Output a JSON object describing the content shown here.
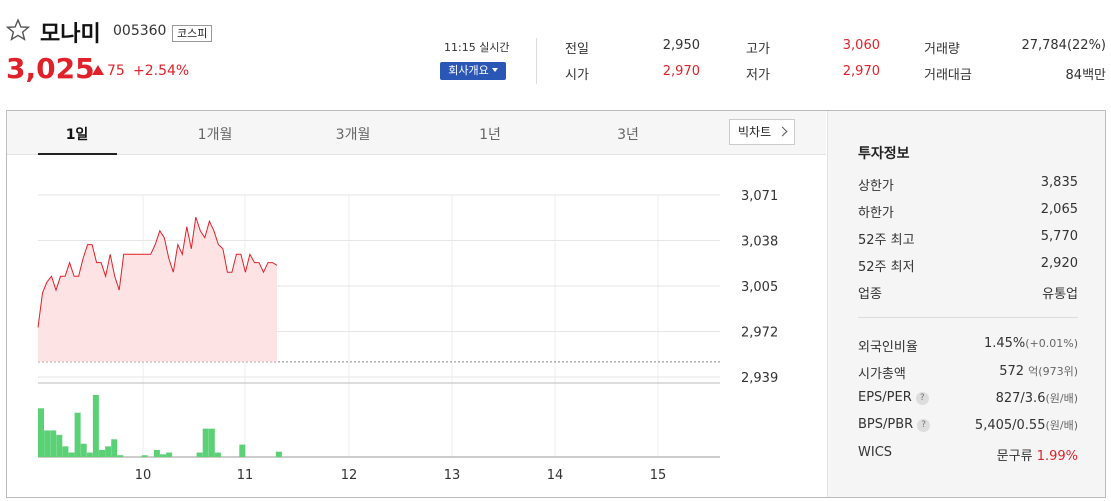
{
  "stock": {
    "name": "모나미",
    "code": "005360",
    "market": "코스피",
    "price": "3,025",
    "change": "75",
    "rate": "+2.54%"
  },
  "header": {
    "realtime": "11:15 실시간",
    "company_btn": "회사개요",
    "stats": [
      {
        "label": "전일",
        "value": "2,950",
        "color": "#333333"
      },
      {
        "label": "시가",
        "value": "2,970",
        "color": "#e0212a"
      },
      {
        "label": "고가",
        "value": "3,060",
        "color": "#e0212a"
      },
      {
        "label": "저가",
        "value": "2,970",
        "color": "#e0212a"
      },
      {
        "label": "거래량",
        "value": "27,784(22%)",
        "color": "#333333"
      },
      {
        "label": "거래대금",
        "value": "84백만",
        "color": "#333333"
      }
    ]
  },
  "tabs": [
    "1일",
    "1개월",
    "3개월",
    "1년",
    "3년"
  ],
  "bigchart": "빅차트",
  "info": {
    "title": "투자정보",
    "rows1": [
      {
        "label": "상한가",
        "value": "3,835",
        "color": "#e0212a"
      },
      {
        "label": "하한가",
        "value": "2,065",
        "color": "#2a57b6"
      },
      {
        "label": "52주 최고",
        "value": "5,770",
        "color": "#333333"
      },
      {
        "label": "52주 최저",
        "value": "2,920",
        "color": "#333333"
      },
      {
        "label": "업종",
        "value": "유통업",
        "color": "#333333"
      }
    ],
    "foreign": {
      "label": "외국인비율",
      "value": "1.45%",
      "sub": "(+0.01%)"
    },
    "mktcap": {
      "label": "시가총액",
      "value": "572",
      "sub": "억(973위)"
    },
    "eps": {
      "label": "EPS/PER",
      "value": "827/3.6",
      "sub": "(원/배)"
    },
    "bps": {
      "label": "BPS/PBR",
      "value": "5,405/0.55",
      "sub": "(원/배)"
    },
    "wics": {
      "label": "WICS",
      "value": "문구류",
      "rate": "1.99%"
    }
  },
  "chart_data": {
    "type": "line",
    "x_ticks": [
      "10",
      "11",
      "12",
      "13",
      "14",
      "15"
    ],
    "y_ticks": [
      "3,071",
      "3,038",
      "3,005",
      "2,972",
      "2,939"
    ],
    "ylim": [
      2939,
      3071
    ],
    "prev_close": 2950,
    "price": [
      2975,
      3000,
      3008,
      3012,
      3002,
      3012,
      3012,
      3022,
      3012,
      3012,
      3025,
      3035,
      3035,
      3022,
      3022,
      3012,
      3028,
      3012,
      3002,
      3028,
      3028,
      3028,
      3028,
      3028,
      3028,
      3028,
      3035,
      3045,
      3040,
      3025,
      3015,
      3035,
      3028,
      3048,
      3032,
      3055,
      3045,
      3040,
      3052,
      3045,
      3035,
      3032,
      3015,
      3015,
      3028,
      3028,
      3015,
      3028,
      3022,
      3022,
      3015,
      3022,
      3022,
      3020
    ],
    "volume": [
      55,
      30,
      30,
      25,
      12,
      5,
      50,
      15,
      5,
      70,
      8,
      12,
      20,
      2,
      0,
      0,
      0,
      2,
      0,
      8,
      3,
      5,
      0,
      0,
      0,
      0,
      5,
      32,
      32,
      5,
      0,
      0,
      0,
      14,
      0,
      0,
      0,
      0,
      0,
      6
    ]
  }
}
